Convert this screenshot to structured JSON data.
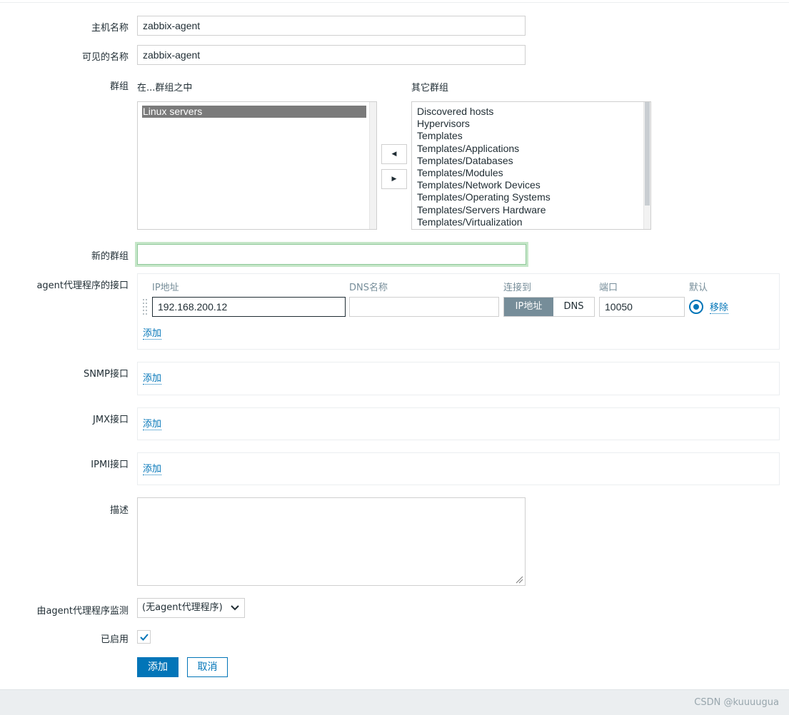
{
  "form": {
    "host_name_label": "主机名称",
    "host_name_value": "zabbix-agent",
    "visible_name_label": "可见的名称",
    "visible_name_value": "zabbix-agent",
    "groups_label": "群组",
    "in_groups_caption": "在...群组之中",
    "other_groups_caption": "其它群组",
    "in_groups": [
      "Linux servers"
    ],
    "other_groups": [
      "Discovered hosts",
      "Hypervisors",
      "Templates",
      "Templates/Applications",
      "Templates/Databases",
      "Templates/Modules",
      "Templates/Network Devices",
      "Templates/Operating Systems",
      "Templates/Servers Hardware",
      "Templates/Virtualization"
    ],
    "move_left_glyph": "◀",
    "move_right_glyph": "▶",
    "new_group_label": "新的群组",
    "new_group_value": "",
    "agent_interface_label": "agent代理程序的接口",
    "interface_columns": {
      "ip": "IP地址",
      "dns": "DNS名称",
      "connect_to": "连接到",
      "port": "端口",
      "default": "默认"
    },
    "agent_interface": {
      "ip_value": "192.168.200.12",
      "dns_value": "",
      "connect_ip": "IP地址",
      "connect_dns": "DNS",
      "port_value": "10050",
      "remove_link": "移除"
    },
    "add_link": "添加",
    "snmp_label": "SNMP接口",
    "jmx_label": "JMX接口",
    "ipmi_label": "IPMI接口",
    "description_label": "描述",
    "description_value": "",
    "monitored_by_label": "由agent代理程序监测",
    "monitored_by_value": "(无agent代理程序)",
    "enabled_label": "已启用",
    "enabled": true,
    "submit_button": "添加",
    "cancel_button": "取消"
  },
  "footer": {
    "watermark": "CSDN @kuuuugua"
  },
  "colors": {
    "accent": "#0275b8",
    "selected_option": "#7a7a7a",
    "connect_active": "#768d99",
    "new_group_focus": "#c5e6c8"
  }
}
